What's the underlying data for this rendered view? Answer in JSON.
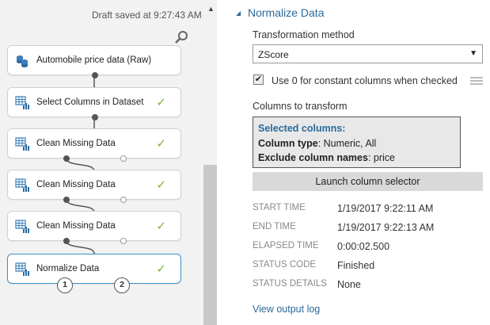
{
  "canvas": {
    "draft_status": "Draft saved at 9:27:43 AM",
    "modules": [
      {
        "label": "Automobile price data (Raw)",
        "icon": "dataset-icon",
        "status": ""
      },
      {
        "label": "Select Columns in Dataset",
        "icon": "module-icon",
        "status": "✓"
      },
      {
        "label": "Clean Missing Data",
        "icon": "module-icon",
        "status": "✓"
      },
      {
        "label": "Clean Missing Data",
        "icon": "module-icon",
        "status": "✓"
      },
      {
        "label": "Clean Missing Data",
        "icon": "module-icon",
        "status": "✓"
      },
      {
        "label": "Normalize Data",
        "icon": "module-icon",
        "status": "✓"
      }
    ],
    "output_ports": [
      "1",
      "2"
    ]
  },
  "panel": {
    "title": "Normalize Data",
    "transformation_method_label": "Transformation method",
    "transformation_method_value": "ZScore",
    "constant_columns_label": "Use 0 for constant columns when checked",
    "constant_columns_checked": true,
    "columns_label": "Columns to transform",
    "selected_columns": {
      "heading": "Selected columns:",
      "type_key": "Column type",
      "type_value": ": Numeric, All",
      "exclude_key": "Exclude column names",
      "exclude_value": ": price"
    },
    "launch_button": "Launch column selector",
    "info": [
      {
        "key": "START TIME",
        "value": "1/19/2017 9:22:11 AM"
      },
      {
        "key": "END TIME",
        "value": "1/19/2017 9:22:13 AM"
      },
      {
        "key": "ELAPSED TIME",
        "value": "0:00:02.500"
      },
      {
        "key": "STATUS CODE",
        "value": "Finished"
      },
      {
        "key": "STATUS DETAILS",
        "value": "None"
      }
    ],
    "view_output_log": "View output log"
  },
  "colors": {
    "accent": "#2b6a9a",
    "check": "#7cb342",
    "selected_border": "#3c8ec7"
  }
}
